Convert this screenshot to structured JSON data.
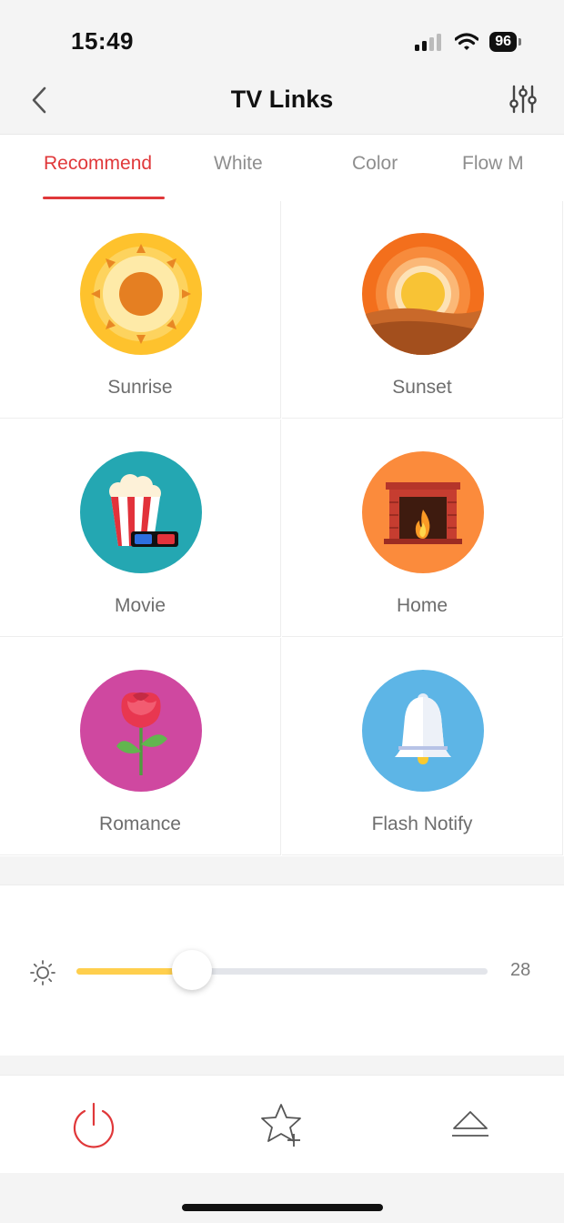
{
  "status_bar": {
    "time": "15:49",
    "battery": "96"
  },
  "nav": {
    "title": "TV Links"
  },
  "tabs": [
    {
      "label": "Recommend",
      "active": true
    },
    {
      "label": "White",
      "active": false
    },
    {
      "label": "Color",
      "active": false
    },
    {
      "label": "Flow M",
      "active": false
    }
  ],
  "scenes": [
    {
      "label": "Sunrise",
      "icon": "sunrise-icon"
    },
    {
      "label": "Sunset",
      "icon": "sunset-icon"
    },
    {
      "label": "Movie",
      "icon": "popcorn-3d-glasses-icon"
    },
    {
      "label": "Home",
      "icon": "fireplace-icon"
    },
    {
      "label": "Romance",
      "icon": "rose-icon"
    },
    {
      "label": "Flash Notify",
      "icon": "bell-icon"
    }
  ],
  "brightness": {
    "value": "28",
    "fraction": 0.28,
    "icon": "brightness-sun-icon"
  },
  "toolbar": {
    "icons": [
      "power-icon",
      "favorite-add-icon",
      "eject-icon"
    ]
  },
  "colors": {
    "accent": "#e0383a",
    "slider_fill": "#ffcf4d"
  }
}
